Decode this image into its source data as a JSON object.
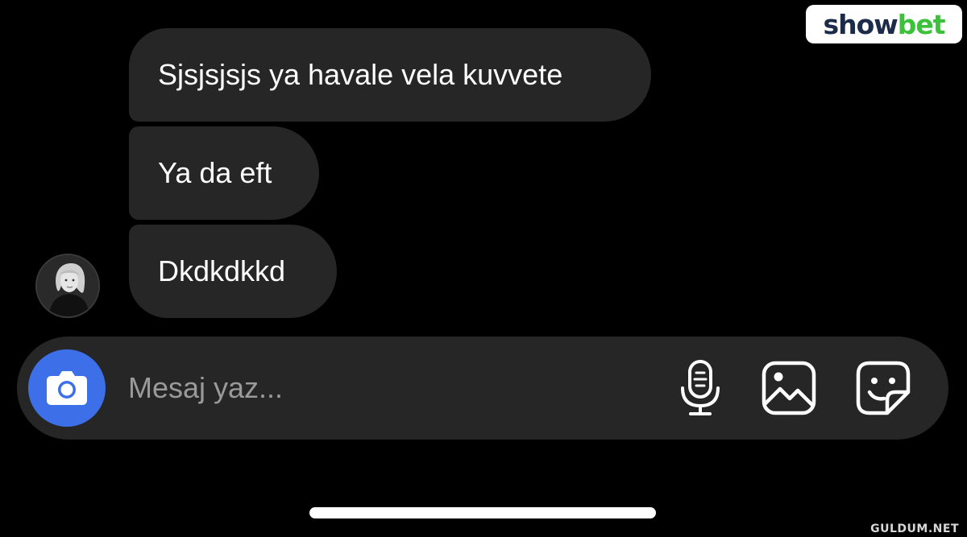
{
  "brand": {
    "logo_show": "show",
    "logo_bet": "bet",
    "colors": {
      "show": "#1c2b4a",
      "bet": "#3cc23a"
    }
  },
  "conversation": {
    "messages": [
      {
        "text": "Sjsjsjsjs ya havale vela kuvvete"
      },
      {
        "text": "Ya da eft"
      },
      {
        "text": "Dkdkdkkd"
      }
    ],
    "avatar_icon": "profile-photo"
  },
  "composer": {
    "placeholder": "Mesaj yaz...",
    "value": "",
    "camera_icon": "camera-icon",
    "tools": [
      "microphone-icon",
      "gallery-icon",
      "sticker-icon"
    ],
    "accent_color": "#3d6fe8"
  },
  "watermark": "GULDUM.NET"
}
